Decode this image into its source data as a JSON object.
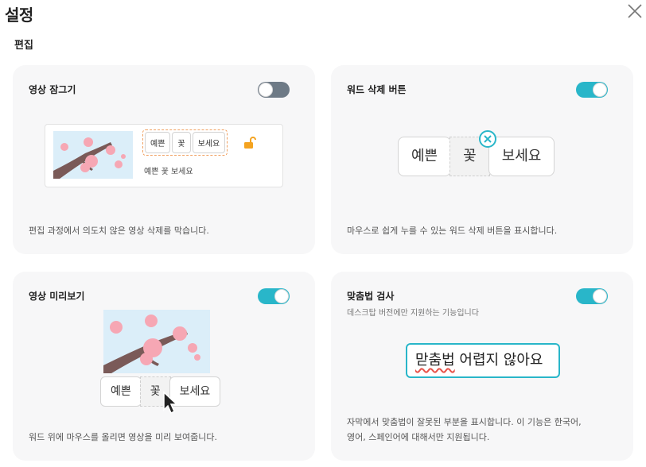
{
  "header": {
    "title": "설정"
  },
  "section": {
    "title": "편집"
  },
  "cards": {
    "lock": {
      "title": "영상 잠그기",
      "enabled": false,
      "chips": [
        "예쁜",
        "꽃",
        "보세요"
      ],
      "caption": "예쁜 꽃 보세요",
      "desc": "편집 과정에서 의도치 않은 영상 삭제를 막습니다."
    },
    "word_delete": {
      "title": "워드 삭제 버튼",
      "enabled": true,
      "chips": [
        "예쁜",
        "꽃",
        "보세요"
      ],
      "desc": "마우스로 쉽게 누를 수 있는 워드 삭제 버튼을 표시합니다."
    },
    "preview": {
      "title": "영상 미리보기",
      "enabled": true,
      "chips": [
        "예쁜",
        "꽃",
        "보세요"
      ],
      "desc": "워드 위에 마우스를 올리면 영상을 미리 보여줍니다."
    },
    "spellcheck": {
      "title": "맞춤법 검사",
      "subtitle": "데스크탑 버전에만 지원하는 기능입니다",
      "enabled": true,
      "sample_error": "맏춤법",
      "sample_rest": " 어렵지 않아요",
      "desc_line1": "자막에서 맞춤법이 잘못된 부분을 표시합니다. 이 기능은 한국어,",
      "desc_line2": "영어, 스페인어에 대해서만 지원됩니다."
    }
  },
  "colors": {
    "accent": "#29b6c9",
    "toggle_off": "#6e7a86",
    "card_bg": "#f7f7f8",
    "lock_orange": "#f4a320",
    "spell_error": "#e8534a"
  },
  "icons": {
    "close": "close-icon",
    "lock": "unlock-icon",
    "delete": "x-circle-icon",
    "cursor": "mouse-pointer-icon"
  }
}
